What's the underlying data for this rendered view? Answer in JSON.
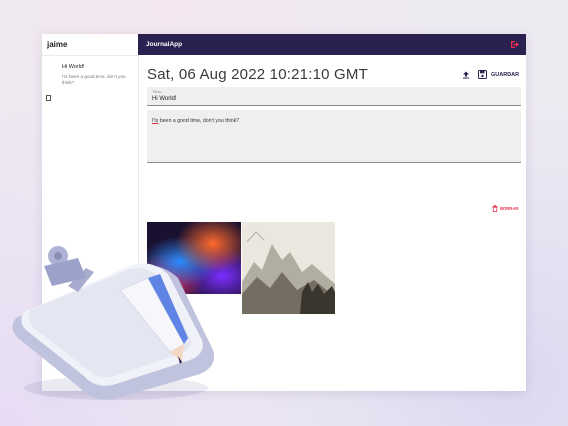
{
  "sidebar": {
    "user_name": "jaime",
    "entries": [
      {
        "title": "Hi World!",
        "body": "I'ts been a good time, don't you think?"
      }
    ]
  },
  "header": {
    "app_title": "JournalApp",
    "logout_icon": "logout-icon"
  },
  "note": {
    "date": "Sat, 06 Aug 2022 10:21:10 GMT",
    "save_label": "GUARDAR",
    "title_label": "Título",
    "title_value": "Hi World!",
    "body_first_word": "I'ts",
    "body_rest": " been a good time, don't you think?",
    "delete_label": "BORRAR"
  },
  "colors": {
    "topbar": "#2b2150",
    "accent": "#f12d50",
    "field": "#efeff0"
  },
  "icons": [
    "note-icon",
    "logout-icon",
    "upload-icon",
    "save-icon",
    "trash-icon",
    "plus-icon"
  ]
}
